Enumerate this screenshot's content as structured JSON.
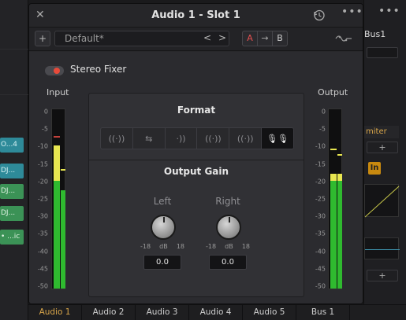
{
  "window": {
    "title": "Audio 1 - Slot 1",
    "close_glyph": "✕",
    "more_glyph": "•••"
  },
  "toolbar": {
    "add_glyph": "+",
    "preset": "Default*",
    "prev_glyph": "<",
    "next_glyph": ">",
    "a_label": "A",
    "copy_glyph": "→",
    "b_label": "B"
  },
  "plugin": {
    "enable_label": "Stereo Fixer",
    "enabled": true,
    "input_label": "Input",
    "output_label": "Output",
    "scale": [
      "0",
      "-5",
      "-10",
      "-15",
      "-20",
      "-25",
      "-30",
      "-35",
      "-40",
      "-45",
      "-50"
    ],
    "format_title": "Format",
    "format_options": [
      {
        "glyph": "((·))",
        "name": "format-stereo"
      },
      {
        "glyph": "⇆",
        "name": "format-swap"
      },
      {
        "glyph": "·))",
        "name": "format-right-only"
      },
      {
        "glyph": "((·))",
        "name": "format-mono-a"
      },
      {
        "glyph": "((·))",
        "name": "format-mono-b"
      },
      {
        "glyph": "🎙🎙",
        "name": "format-dual-mic"
      }
    ],
    "format_selected": 5,
    "gain_title": "Output Gain",
    "left": {
      "label": "Left",
      "min": "-18",
      "unit": "dB",
      "max": "18",
      "value": "0.0"
    },
    "right": {
      "label": "Right",
      "min": "-18",
      "unit": "dB",
      "max": "18",
      "value": "0.0"
    }
  },
  "meters": {
    "input_levels_db": [
      -10.0,
      -22.5
    ],
    "input_peaks_db": [
      -8,
      -17
    ],
    "output_levels_db": [
      -18.0,
      -18.0
    ],
    "output_peaks_db": [
      -11.5,
      -13.0
    ],
    "colors": {
      "green": "#2fba2f",
      "yellow": "#e8e650",
      "peak_red": "#c2413b"
    }
  },
  "background": {
    "left_tracks": [
      "O...4",
      "DJ...",
      "DJ...",
      "DJ...",
      "• ...ic"
    ],
    "right_dots": "•••",
    "bus_label": "Bus1",
    "limiter_label": "miter",
    "add_glyph": "+",
    "in_label": "In"
  },
  "bottom_tabs": [
    "Audio 1",
    "Audio 2",
    "Audio 3",
    "Audio 4",
    "Audio 5",
    "Bus 1"
  ],
  "bottom_active": 0
}
